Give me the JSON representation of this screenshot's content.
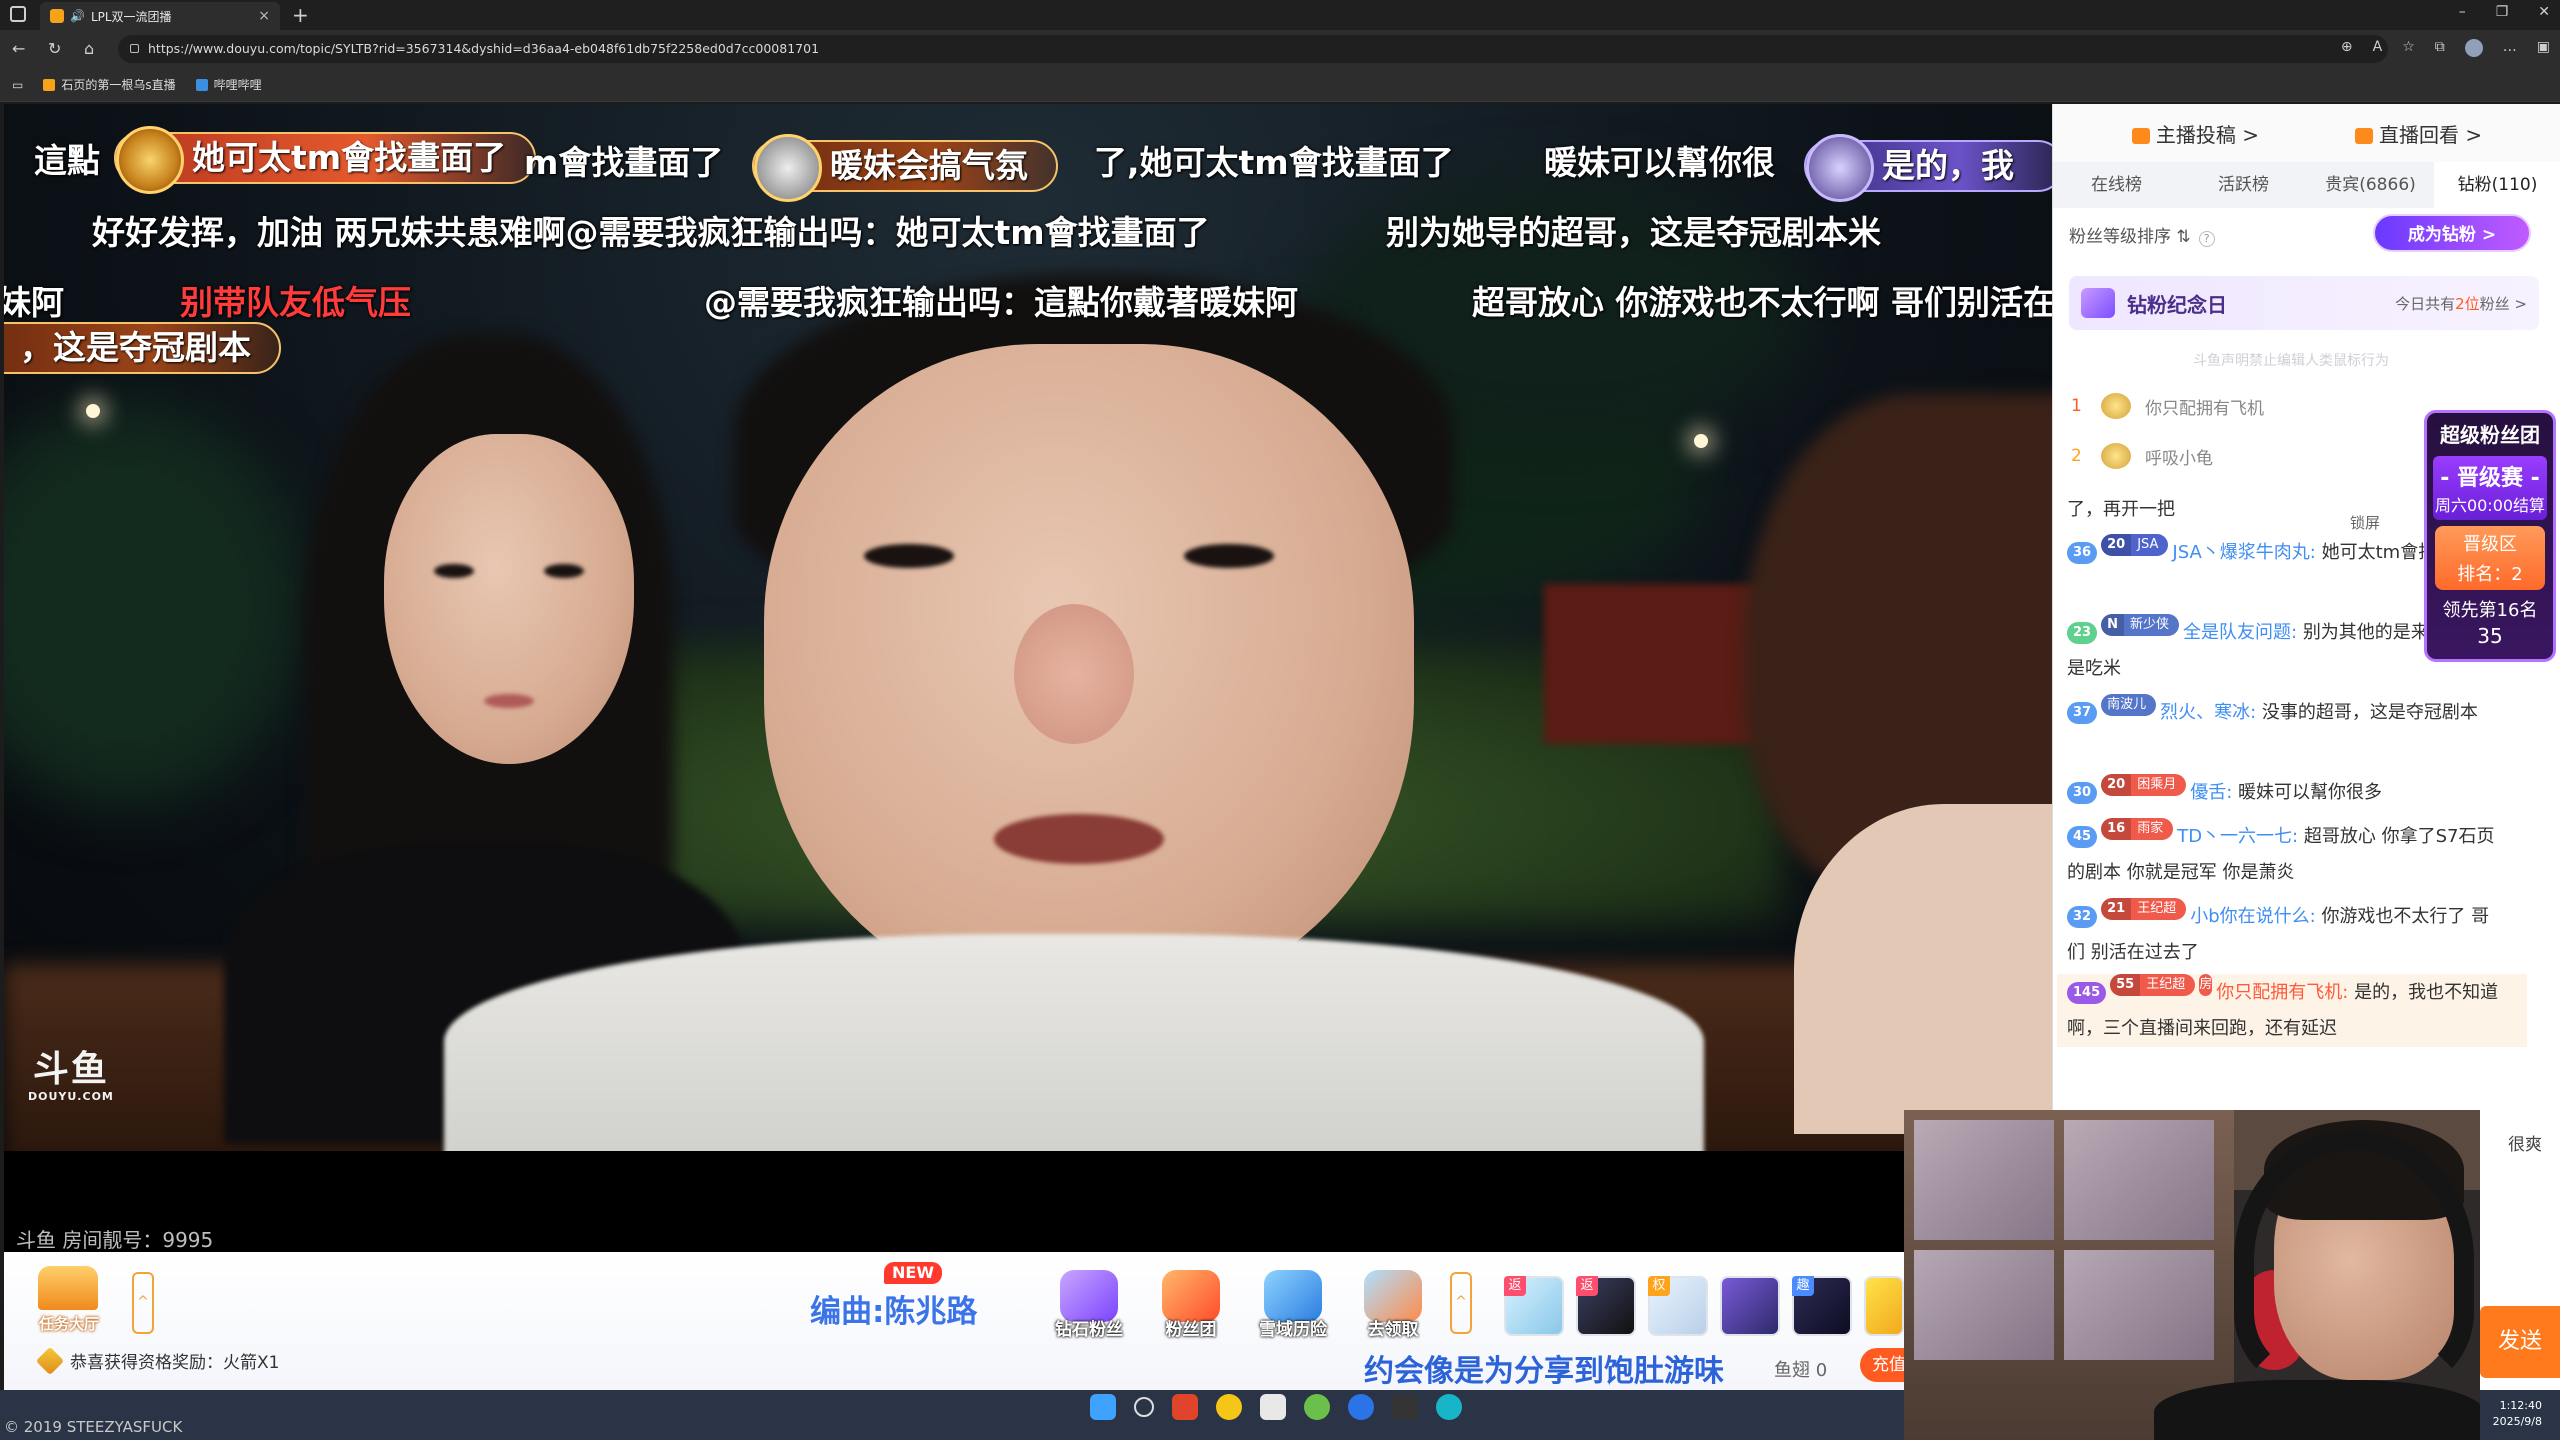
{
  "browser": {
    "tab_title": "LPL双一流团播",
    "tab_new": "+",
    "tab_close": "×",
    "speaker_icon": "speaker-icon",
    "url": "https://www.douyu.com/topic/SYLTB?rid=3567314&dyshid=d36aa4-eb048f61db75f2258ed0d7cc00081701",
    "window_controls": [
      "–",
      "❐",
      "✕"
    ],
    "bookmarks": [
      "石页的第一根乌s直播",
      "哔哩哔哩"
    ]
  },
  "danmaku": {
    "row1": [
      {
        "text": "這點"
      },
      {
        "text": "她可太tm會找畫面了",
        "style": "pill"
      },
      {
        "text": "m會找畫面了"
      },
      {
        "text": "暖妹会搞气氛",
        "style": "pill"
      },
      {
        "text": "了,她可太tm會找畫面了"
      },
      {
        "text": "暖妹可以幫你很"
      },
      {
        "text": "是的，我",
        "style": "pill"
      }
    ],
    "row2": [
      {
        "text": "好好发挥，加油  两兄妹共患难啊@需要我疯狂输出吗：她可太tm會找畫面了"
      },
      {
        "text": "别为她导的超哥，这是夺冠剧本米"
      }
    ],
    "row3": [
      {
        "text": "妹阿"
      },
      {
        "text": "别带队友低气压",
        "color": "red"
      },
      {
        "text": "@需要我疯狂输出吗：這點你戴著暖妹阿"
      },
      {
        "text": "超哥放心 你游戏也不太行啊 哥们别活在过去了"
      }
    ],
    "row4": [
      {
        "text": "，这是夺冠剧本",
        "style": "pill"
      }
    ]
  },
  "video": {
    "logo_big": "斗鱼",
    "logo_small": "DOUYU.COM",
    "room_number": "斗鱼 房间靓号：9995"
  },
  "bottom_bar": {
    "task_hall": "任务大厅",
    "new_badge": "NEW",
    "song_text": "编曲:陈兆路",
    "activities": [
      "钻石粉丝",
      "粉丝团",
      "雪域历险",
      "去领取"
    ],
    "gift_tags": [
      "返",
      "返",
      "权",
      "",
      "趣",
      ""
    ],
    "reward_text": "恭喜获得资格奖励：火箭X1",
    "slogan": "约会像是为分享到饱肚游味",
    "fish_wing": "鱼翅 0",
    "recharge": "充值"
  },
  "footer": {
    "copyright": "© 2019 STEEZYASFUCK",
    "clock_time": "1:12:40",
    "clock_date": "2025/9/8"
  },
  "side": {
    "top_links": [
      "主播投稿 >",
      "直播回看 >"
    ],
    "rank_tabs": [
      "在线榜",
      "活跃榜",
      "贵宾(6866)",
      "钻粉(110)"
    ],
    "fan_sort": "粉丝等级排序 ⇅",
    "become_diamond": "成为钻粉 >",
    "memorial_title": "钻粉纪念日",
    "memorial_today_prefix": "今日共有",
    "memorial_count": "2位",
    "memorial_suffix": "粉丝 >",
    "watch_hint": "斗鱼声明禁止编辑人类鼠标行为",
    "fans": [
      {
        "rank": "1",
        "name": "你只配拥有飞机"
      },
      {
        "rank": "2",
        "name": "呼吸小龟"
      }
    ],
    "lock_label": "锁屏",
    "messages": [
      {
        "pre": "了，再开一把"
      },
      {
        "level": "36",
        "badge_lvl": "20",
        "badge_name": "JSA",
        "name": "JSA丶爆浆牛肉丸:",
        "text": "她可太tm會找畫面了"
      },
      {
        "level": "23",
        "badge_lvl": "N",
        "badge_name": "新少侠",
        "name": "全是队友问题:",
        "text": "别为其他的是来户外就是吃米"
      },
      {
        "level": "37",
        "badge_lvl": "",
        "badge_name": "南波儿",
        "name": "烈火、寒冰:",
        "text": "没事的超哥，这是夺冠剧本"
      },
      {
        "level": "30",
        "badge_lvl": "20",
        "badge_name": "困乘月",
        "name": "優舌:",
        "text": "暖妹可以幫你很多"
      },
      {
        "level": "45",
        "badge_lvl": "16",
        "badge_name": "雨家",
        "name": "TD丶一六一七:",
        "text": "超哥放心 你拿了S7石页的剧本 你就是冠军 你是萧炎"
      },
      {
        "level": "32",
        "badge_lvl": "21",
        "badge_name": "王纪超",
        "name": "小b你在说什么:",
        "text": "你游戏也不太行了 哥们 别活在过去了"
      },
      {
        "level": "145",
        "badge_lvl": "55",
        "badge_name": "王纪超",
        "room": "房",
        "name": "你只配拥有飞机:",
        "text": "是的，我也不知道啊，三个直播间来回跑，还有延迟"
      }
    ],
    "tail_text": "很爽",
    "send": "发送"
  },
  "superfan": {
    "title": "超级粉丝团",
    "promo_title": "- 晋级赛 -",
    "promo_time": "周六00:00结算",
    "zone": "晋级区",
    "rank": "排名：2",
    "lead": "领先第16名",
    "lead_num": "35"
  }
}
